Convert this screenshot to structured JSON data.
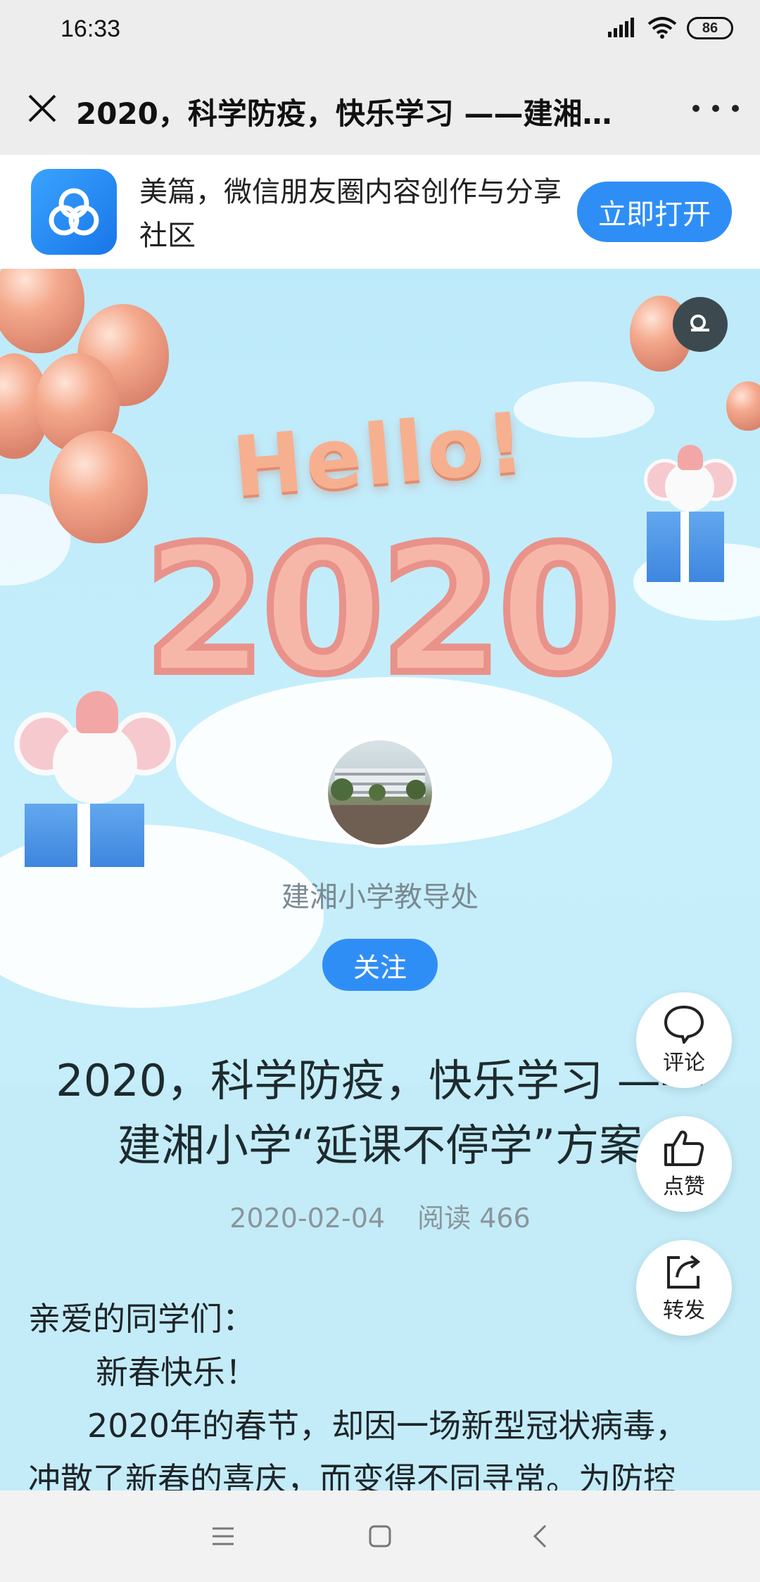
{
  "status": {
    "time": "16:33",
    "battery": "86"
  },
  "nav": {
    "title": "2020，科学防疫，快乐学习 ——建湘…"
  },
  "app_banner": {
    "description": "美篇，微信朋友圈内容创作与分享社区",
    "open_label": "立即打开"
  },
  "hero": {
    "hello_text": "Hello!",
    "year_text": "2020"
  },
  "author": {
    "name": "建湘小学教导处",
    "follow_label": "关注"
  },
  "article": {
    "title": "2020，科学防疫，快乐学习 —— 建湘小学“延课不停学”方案",
    "date": "2020-02-04",
    "reads": "阅读 466",
    "paragraphs": [
      "亲爱的同学们：",
      "新春快乐！",
      "2020年的春节，却因一场新型冠状病毒，",
      "冲散了新春的喜庆，而变得不同寻常。为防控"
    ]
  },
  "actions": {
    "comment": "评论",
    "like": "点赞",
    "share": "转发"
  },
  "colors": {
    "accent": "#2f8ef6",
    "hero_bg": "#c3ecf8"
  }
}
